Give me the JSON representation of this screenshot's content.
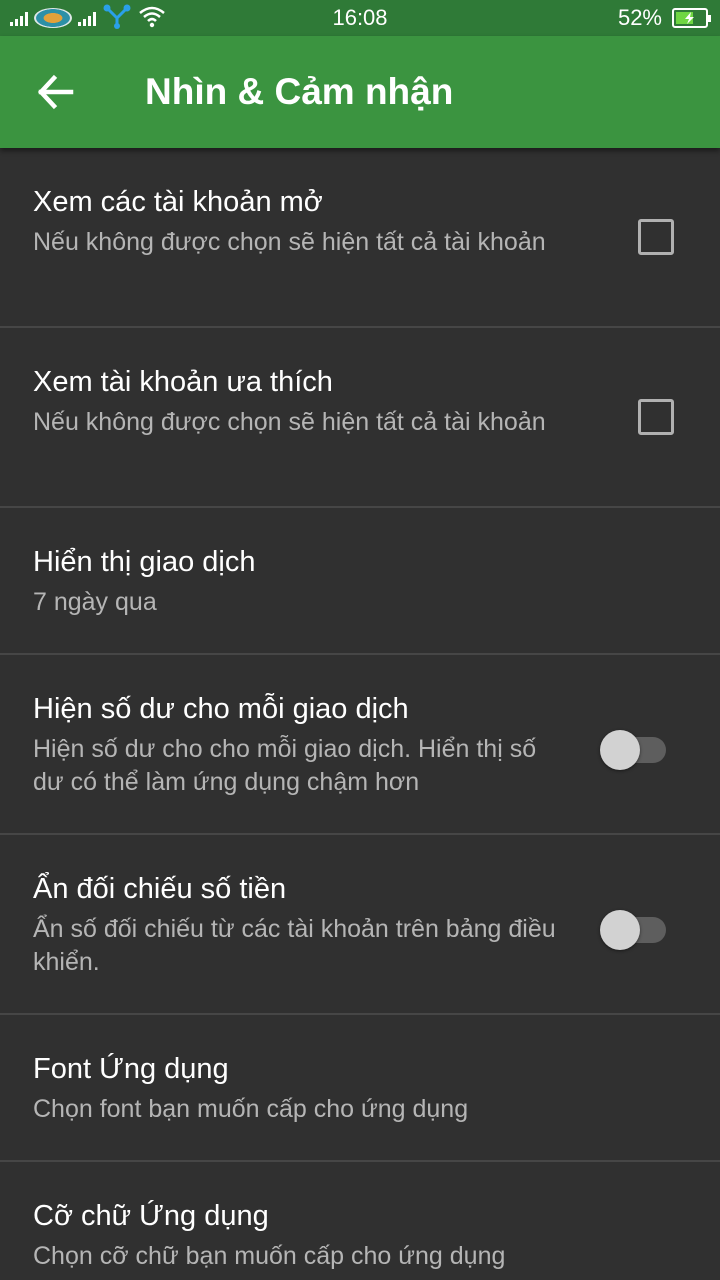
{
  "status_bar": {
    "time": "16:08",
    "battery_percent": "52%",
    "battery_level": 0.52,
    "icons": [
      "signal-icon",
      "carrier-logo-icon",
      "signal-icon",
      "data-network-icon",
      "wifi-icon",
      "battery-charging-icon"
    ]
  },
  "app_bar": {
    "back_icon": "arrow-left-icon",
    "title": "Nhìn & Cảm nhận"
  },
  "settings": [
    {
      "title": "Xem các tài khoản mở",
      "summary": "Nếu không được chọn sẽ hiện tất cả tài khoản",
      "control": "checkbox",
      "checked": false
    },
    {
      "title": "Xem tài khoản ưa thích",
      "summary": "Nếu không được chọn sẽ hiện tất cả tài khoản",
      "control": "checkbox",
      "checked": false
    },
    {
      "title": "Hiển thị giao dịch",
      "summary": "7 ngày qua",
      "control": "none"
    },
    {
      "title": "Hiện số dư cho mỗi giao dịch",
      "summary": "Hiện số dư cho cho mỗi giao dịch. Hiển thị số dư có thể làm ứng dụng chậm hơn",
      "control": "switch",
      "checked": false
    },
    {
      "title": "Ẩn đối chiếu số tiền",
      "summary": "Ẩn số đối chiếu từ các tài khoản trên bảng điều khiển.",
      "control": "switch",
      "checked": false
    },
    {
      "title": "Font Ứng dụng",
      "summary": "Chọn font bạn muốn cấp cho ứng dụng",
      "control": "none"
    },
    {
      "title": "Cỡ chữ Ứng dụng",
      "summary": "Chọn cỡ chữ bạn muốn cấp cho ứng dụng",
      "control": "none"
    }
  ],
  "colors": {
    "app_bar": "#3b9440",
    "status_bar": "#2f7a37",
    "background": "#303030",
    "divider": "#464646",
    "title_text": "#ffffff",
    "summary_text": "#b5b5b5"
  }
}
